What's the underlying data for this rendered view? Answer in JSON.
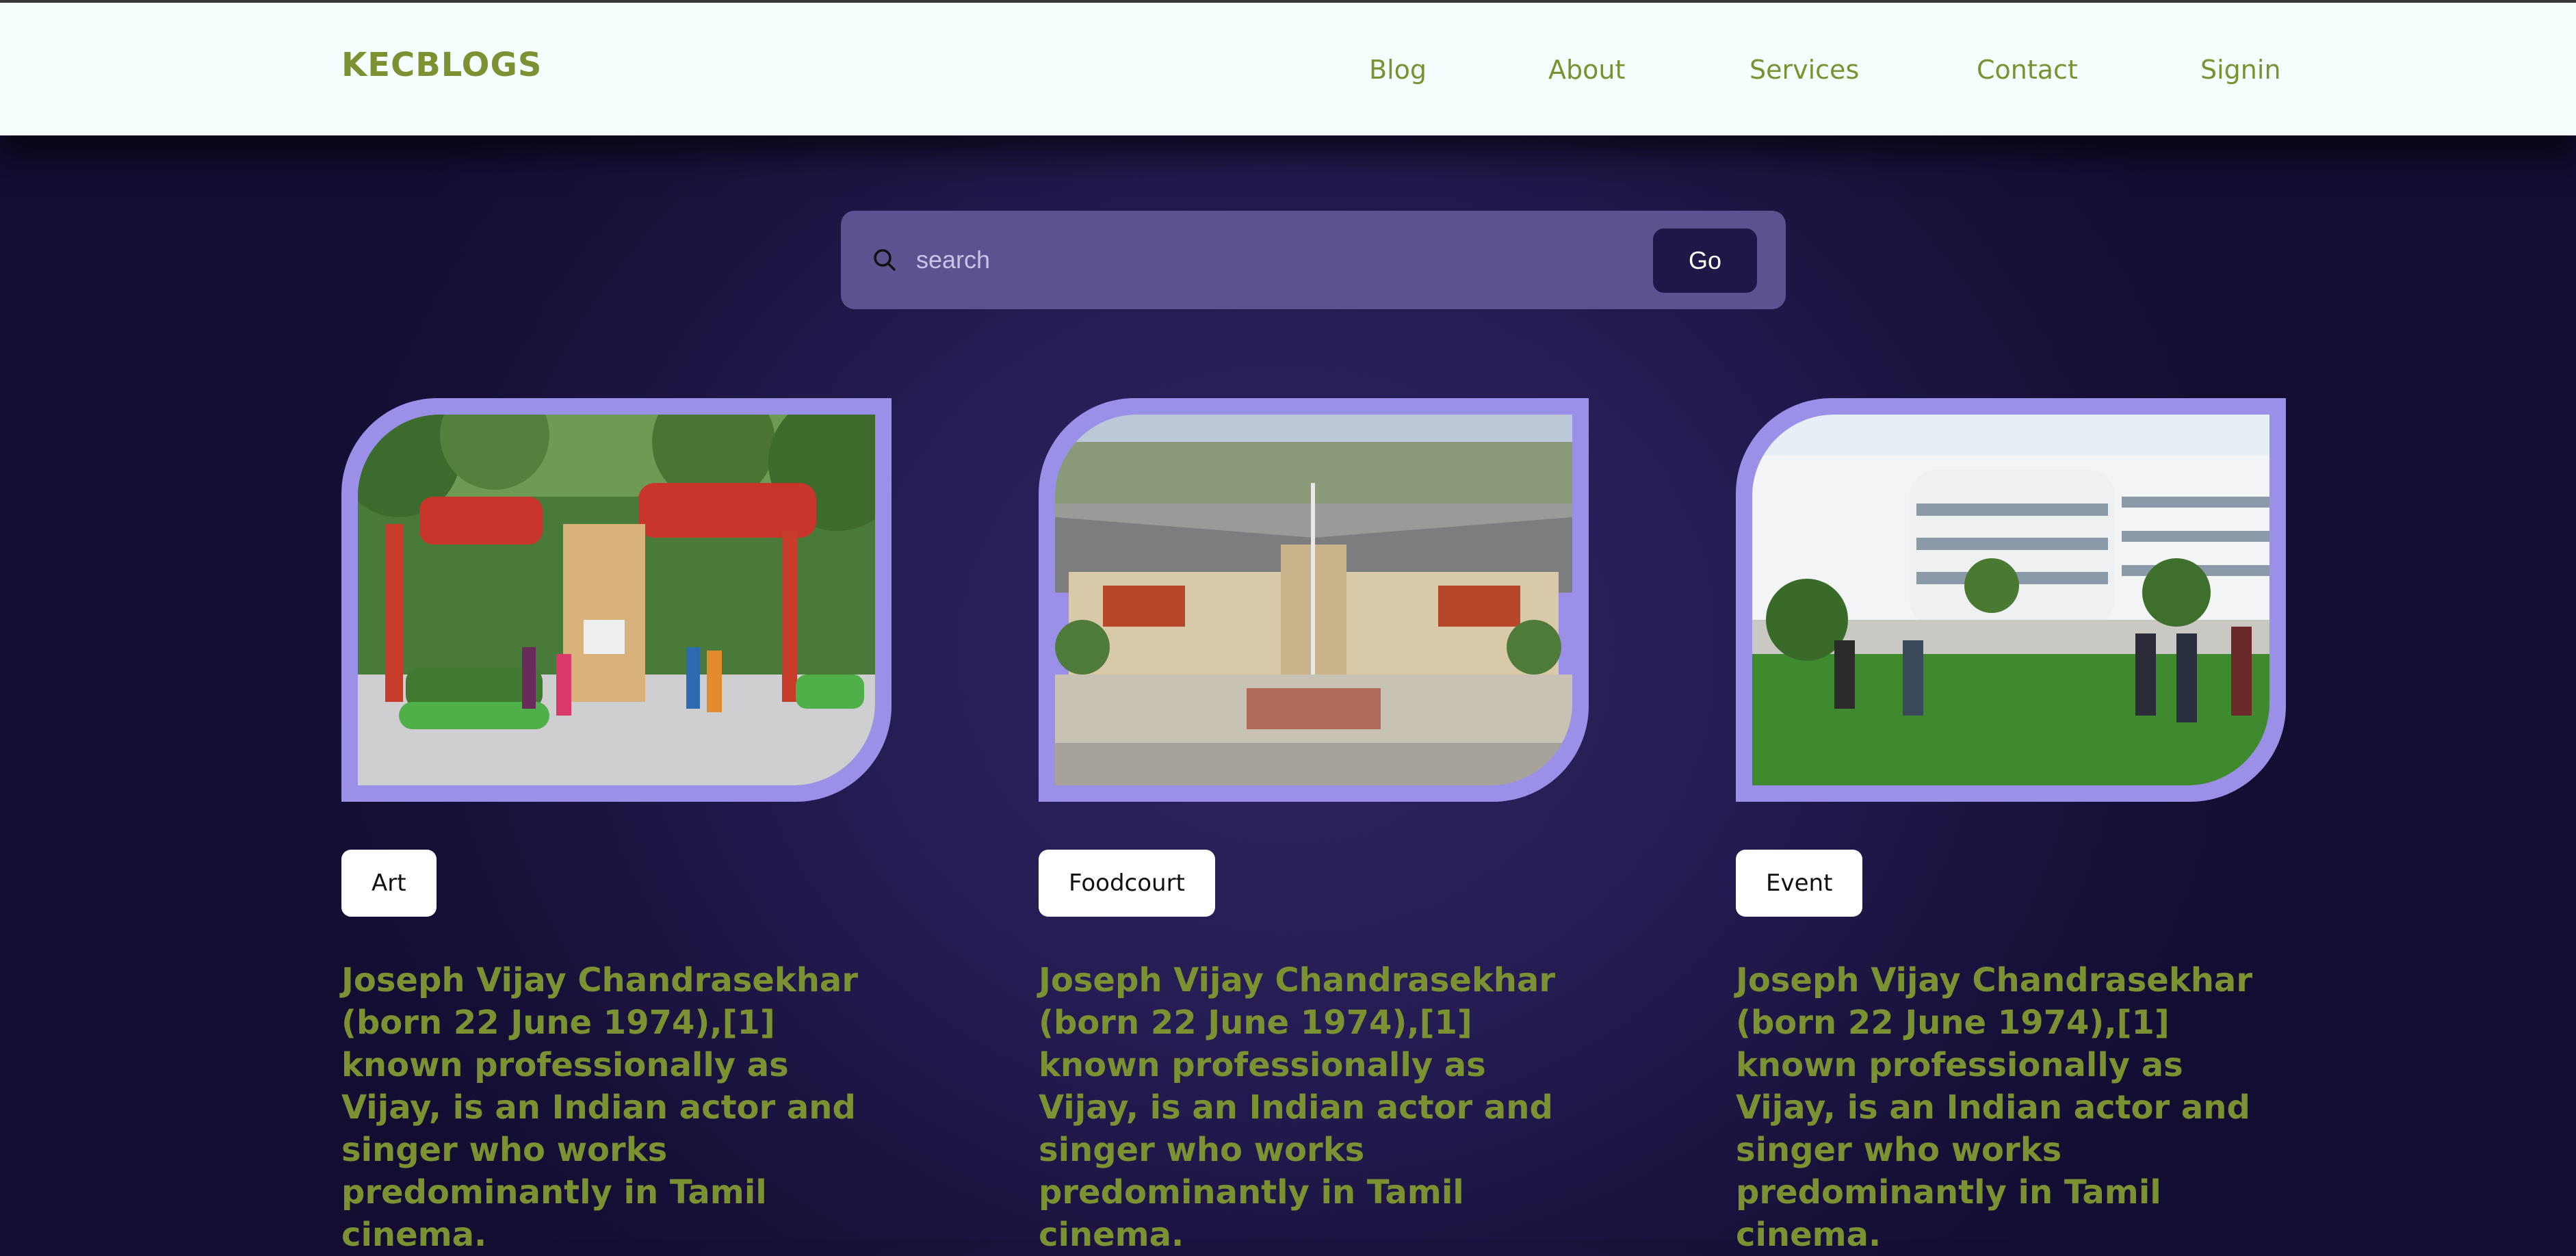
{
  "header": {
    "logo": "KECBLOGS",
    "nav": [
      "Blog",
      "About",
      "Services",
      "Contact",
      "Signin"
    ]
  },
  "search": {
    "placeholder": "search",
    "value": "",
    "go_label": "Go",
    "icon": "search-icon"
  },
  "cards": [
    {
      "tag": "Art",
      "title": "Joseph Vijay Chandrasekhar (born 22 June 1974),[1] known professionally as Vijay, is an Indian actor and singer who works predominantly in Tamil cinema.",
      "image": "college-gate-photo"
    },
    {
      "tag": "Foodcourt",
      "title": "Joseph Vijay Chandrasekhar (born 22 June 1974),[1] known professionally as Vijay, is an Indian actor and singer who works predominantly in Tamil cinema.",
      "image": "college-building-aerial-photo"
    },
    {
      "tag": "Event",
      "title": "Joseph Vijay Chandrasekhar (born 22 June 1974),[1] known professionally as Vijay, is an Indian actor and singer who works predominantly in Tamil cinema.",
      "image": "it-park-building-photo"
    }
  ],
  "colors": {
    "accent_green": "#7c9232",
    "header_bg": "#f4fefd",
    "card_frame": "#9b90e8",
    "search_bg": "#5b5290",
    "go_button_bg": "#1e1848",
    "page_bg": "#241c52"
  }
}
